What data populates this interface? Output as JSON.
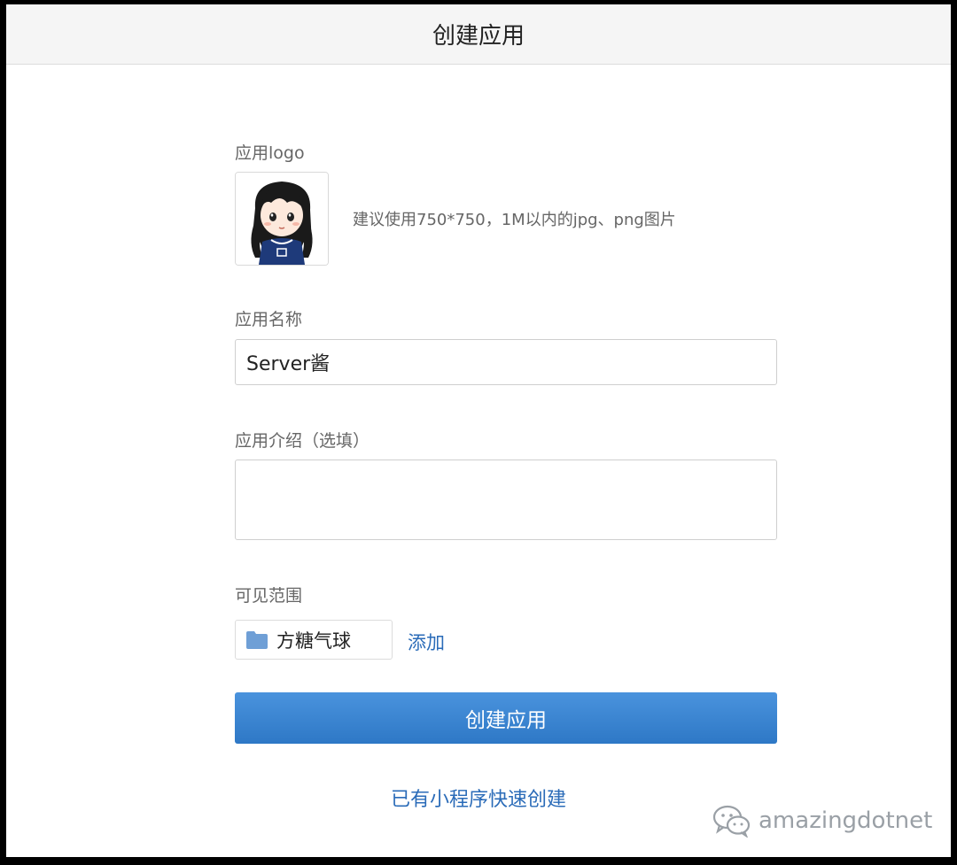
{
  "header": {
    "title": "创建应用"
  },
  "logo": {
    "label": "应用logo",
    "hint": "建议使用750*750，1M以内的jpg、png图片"
  },
  "name": {
    "label": "应用名称",
    "value": "Server酱"
  },
  "description": {
    "label": "应用介绍（选填）",
    "value": ""
  },
  "visibility": {
    "label": "可见范围",
    "scope": "方糖气球",
    "add_label": "添加"
  },
  "actions": {
    "create_label": "创建应用",
    "quick_create_label": "已有小程序快速创建"
  },
  "watermark": {
    "text": "amazingdotnet"
  },
  "colors": {
    "accent": "#2e78c6",
    "link": "#2a6bb8",
    "folder": "#6f9fd6"
  },
  "icons": {
    "folder": "folder-icon",
    "logo": "avatar-image",
    "watermark": "wechat-icon"
  }
}
